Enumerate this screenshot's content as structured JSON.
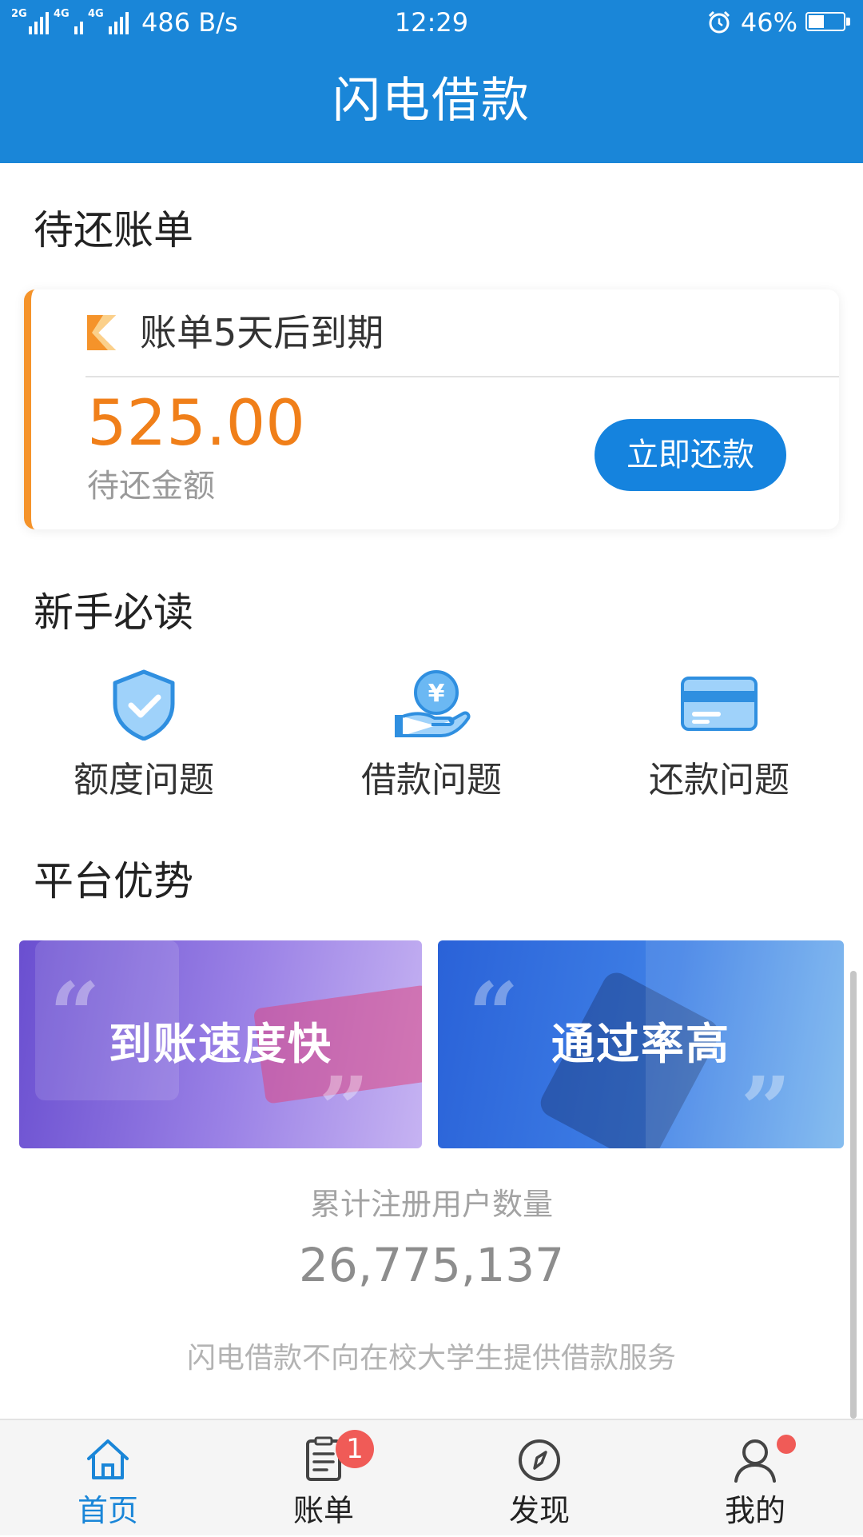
{
  "status_bar": {
    "network_1": "2G",
    "network_2": "4G",
    "network_3": "4G",
    "speed": "486 B/s",
    "time": "12:29",
    "battery_percent": "46%",
    "battery_level": 0.46
  },
  "header": {
    "title": "闪电借款"
  },
  "bill_section": {
    "title": "待还账单",
    "due_text": "账单5天后到期",
    "amount": "525.00",
    "amount_label": "待还金额",
    "repay_button": "立即还款"
  },
  "guide_section": {
    "title": "新手必读",
    "items": [
      {
        "label": "额度问题",
        "icon": "shield-check-icon"
      },
      {
        "label": "借款问题",
        "icon": "yuan-hand-icon"
      },
      {
        "label": "还款问题",
        "icon": "credit-card-icon"
      }
    ]
  },
  "advantages_section": {
    "title": "平台优势",
    "cards": [
      {
        "label": "到账速度快"
      },
      {
        "label": "通过率高"
      }
    ]
  },
  "stats": {
    "label": "累计注册用户数量",
    "value": "26,775,137"
  },
  "disclaimer": "闪电借款不向在校大学生提供借款服务",
  "bottom_nav": {
    "items": [
      {
        "label": "首页",
        "icon": "home-icon",
        "active": true
      },
      {
        "label": "账单",
        "icon": "bill-icon",
        "badge": "1"
      },
      {
        "label": "发现",
        "icon": "compass-icon"
      },
      {
        "label": "我的",
        "icon": "user-icon",
        "dot": true
      }
    ]
  },
  "colors": {
    "primary": "#1a86d8",
    "accent_orange": "#f07f19",
    "badge_red": "#f05b57"
  }
}
